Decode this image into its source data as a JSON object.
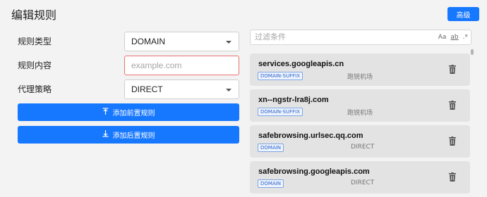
{
  "header": {
    "title": "编辑规则",
    "advanced_label": "高级"
  },
  "form": {
    "rule_type": {
      "label": "规则类型",
      "value": "DOMAIN"
    },
    "rule_content": {
      "label": "规则内容",
      "placeholder": "example.com",
      "value": ""
    },
    "proxy_policy": {
      "label": "代理策略",
      "value": "DIRECT"
    },
    "add_front_label": "添加前置规则",
    "add_back_label": "添加后置规则"
  },
  "filter": {
    "placeholder": "过滤条件",
    "opts": [
      "Aa",
      "ab",
      ".*"
    ]
  },
  "rules": [
    {
      "name": "services.googleapis.cn",
      "type": "DOMAIN-SUFFIX",
      "policy": "跑锐机场"
    },
    {
      "name": "xn--ngstr-lra8j.com",
      "type": "DOMAIN-SUFFIX",
      "policy": "跑锐机场"
    },
    {
      "name": "safebrowsing.urlsec.qq.com",
      "type": "DOMAIN",
      "policy": "DIRECT"
    },
    {
      "name": "safebrowsing.googleapis.com",
      "type": "DOMAIN",
      "policy": "DIRECT"
    }
  ],
  "colors": {
    "accent": "#1677ff",
    "error": "#e8736f",
    "card": "#e3e3e3"
  }
}
